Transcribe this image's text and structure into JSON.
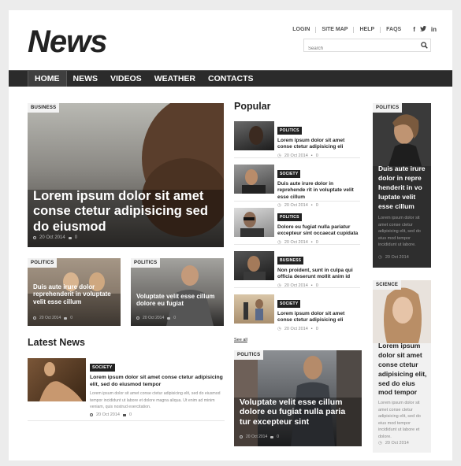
{
  "header": {
    "logo": "News",
    "links": [
      "LOGIN",
      "SITE MAP",
      "HELP",
      "FAQS"
    ],
    "social": [
      "f",
      "t",
      "in"
    ],
    "search_placeholder": "Search"
  },
  "nav": [
    "HOME",
    "NEWS",
    "VIDEOS",
    "WEATHER",
    "CONTACTS"
  ],
  "featured": {
    "badge": "BUSINESS",
    "title": "Lorem ipsum dolor sit amet conse ctetur adipisicing sed do eiusmod",
    "date": "20 Oct 2014",
    "comments": "0"
  },
  "small_cards": [
    {
      "badge": "POLITICS",
      "title": "Duis aute irure dolor reprehenderit in voluptate velit esse cillum",
      "date": "20 Oct 2014",
      "comments": "0"
    },
    {
      "badge": "POLITICS",
      "title": "Voluptate velit esse cillum dolore eu fugiat",
      "date": "20 Oct 2014",
      "comments": "0"
    }
  ],
  "latest": {
    "heading": "Latest News",
    "badge": "SOCIETY",
    "title": "Lorem ipsum dolor sit amet conse ctetur adipisicing elit, sed do eiusmod tempor",
    "body": "Lorem ipsum dolor sit amet conse ctetur adipisicing elit, sed do eiusmod tempor incididunt ut labore et dolore magna aliqua. Ut enim ad minim veniam, quis nostrud exercitation.",
    "date": "20 Oct 2014",
    "comments": "0"
  },
  "popular": {
    "heading": "Popular",
    "see_all": "See all",
    "items": [
      {
        "badge": "POLITICS",
        "title": "Lorem ipsum dolor sit amet conse ctetur adipisicing eli",
        "date": "20 Oct 2014",
        "comments": "0"
      },
      {
        "badge": "SOCIETY",
        "title": "Duis aute irure dolor in reprehende rit in voluptate velit esse cillum",
        "date": "20 Oct 2014",
        "comments": "0"
      },
      {
        "badge": "POLITICS",
        "title": "Dolore eu fugiat nulla pariatur excepteur sint occaecat cupidata",
        "date": "20 Oct 2014",
        "comments": "0"
      },
      {
        "badge": "BUSINESS",
        "title": "Non proident, sunt in culpa qui officia deserunt mollit anim id",
        "date": "20 Oct 2014",
        "comments": "0"
      },
      {
        "badge": "SOCIETY",
        "title": "Lorem ipsum dolor sit amet conse ctetur adipisicing eli",
        "date": "20 Oct 2014",
        "comments": "0"
      }
    ]
  },
  "politics_big": {
    "badge": "POLITICS",
    "title": "Voluptate velit esse cillum dolore eu fugiat nulla paria tur excepteur sint",
    "date": "20 Oct 2014",
    "comments": "0"
  },
  "sidebar": [
    {
      "badge": "POLITICS",
      "title": "Duis aute irure dolor in repre henderit in vo luptate velit esse cillum",
      "body": "Lorem ipsum dolor sit amet conse ctetur adipisicing elit, sed do eius mod tempor incididunt ut labore.",
      "date": "20 Oct 2014"
    },
    {
      "badge": "SCIENCE",
      "title": "Lorem ipsum dolor sit amet conse ctetur adipisicing elit, sed do eius mod tempor",
      "body": "Lorem ipsum dolor sit amet conse ctetur adipisicing elit, sed do eius mod tempor incididunt ut labore et dolore.",
      "date": "20 Oct 2014"
    }
  ]
}
